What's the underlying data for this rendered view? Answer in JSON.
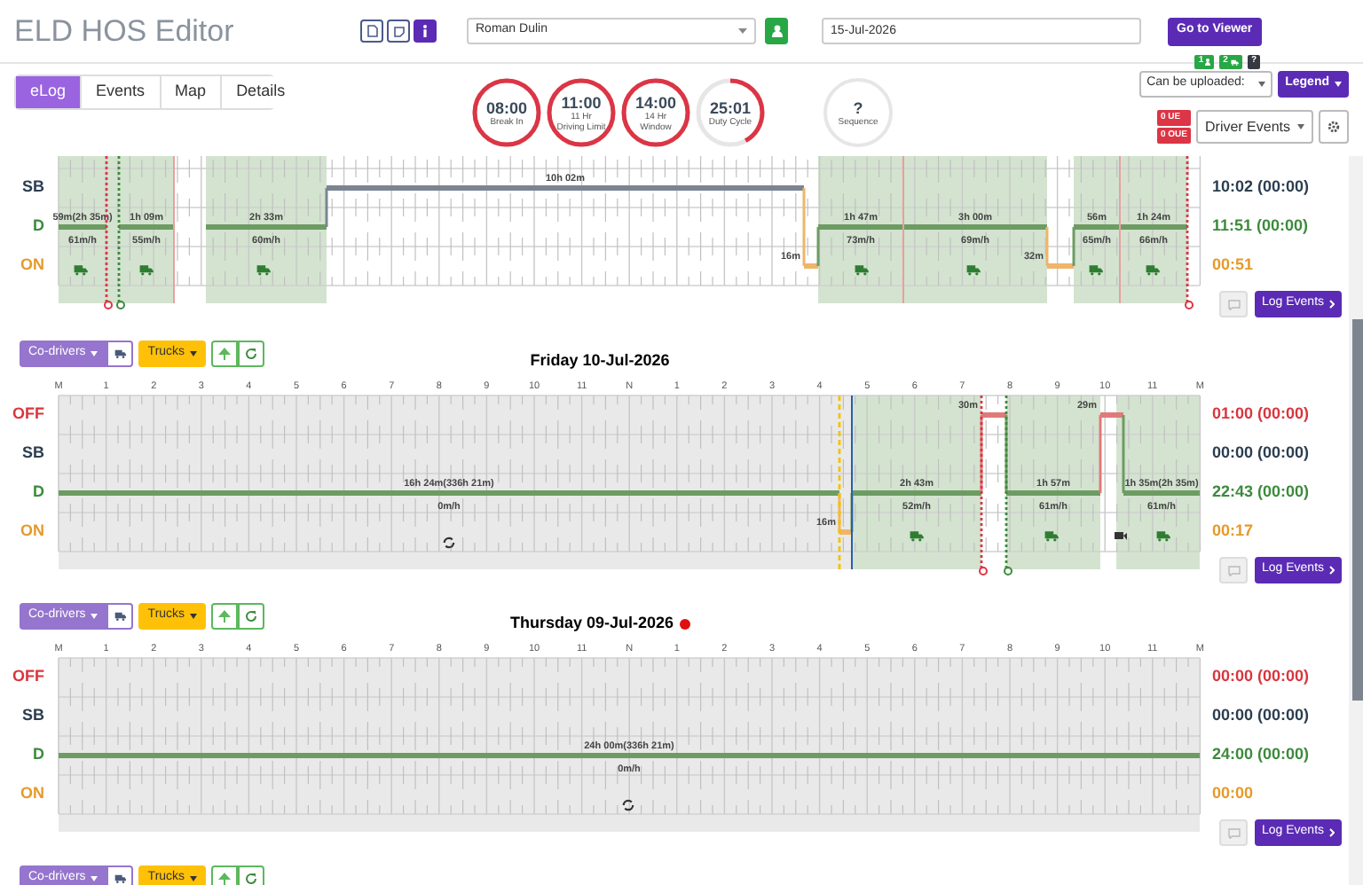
{
  "header": {
    "title": "ELD HOS Editor",
    "driver": {
      "value": "Roman Dulin"
    },
    "date": {
      "value": "15-Jul-2026"
    },
    "viewer_button": "Go to Viewer"
  },
  "tabs": [
    {
      "label": "eLog",
      "selected": true
    },
    {
      "label": "Events",
      "selected": false
    },
    {
      "label": "Map",
      "selected": false
    },
    {
      "label": "Details",
      "selected": false
    }
  ],
  "clocks": [
    {
      "time": "08:00",
      "caption": "Break In",
      "level": 1
    },
    {
      "time": "11:00",
      "sublabel": "11 Hr",
      "caption": "Driving Limit",
      "level": 1
    },
    {
      "time": "14:00",
      "sublabel": "14 Hr",
      "caption": "Window",
      "level": 1
    },
    {
      "time": "25:01",
      "caption": "Duty Cycle",
      "level": 0.42
    }
  ],
  "sequence": {
    "value": "?",
    "caption": "Sequence"
  },
  "sync_badges": [
    {
      "kind": "driver",
      "count": "1"
    },
    {
      "kind": "vehicle",
      "count": "2"
    },
    {
      "kind": "unknown",
      "count": "?"
    }
  ],
  "upload_dropdown": "Can be uploaded:",
  "legend_button": "Legend",
  "counters": [
    "0 UE",
    "0 OUE"
  ],
  "driver_events": "Driver Events",
  "days": [
    {
      "rows": [
        {
          "kind": "sb",
          "label": "SB",
          "total": "10:02 (00:00)"
        },
        {
          "kind": "d",
          "label": "D",
          "total": "11:51 (00:00)"
        },
        {
          "kind": "on",
          "label": "ON",
          "total": "00:51"
        }
      ],
      "segments": [
        {
          "duration": "59m(2h 35m)",
          "speed": "61m/h"
        },
        {
          "duration": "1h 09m",
          "speed": "55m/h"
        },
        {
          "duration": "2h 33m",
          "speed": "60m/h"
        },
        {
          "duration": "10h 02m"
        },
        {
          "duration": "16m"
        },
        {
          "duration": "1h 47m",
          "speed": "73m/h"
        },
        {
          "duration": "3h 00m",
          "speed": "69m/h"
        },
        {
          "duration": "32m"
        },
        {
          "duration": "56m",
          "speed": "65m/h"
        },
        {
          "duration": "1h 24m",
          "speed": "66m/h"
        }
      ],
      "log_events": "Log Events"
    },
    {
      "toolbar": {
        "codrivers": "Co-drivers",
        "trucks": "Trucks"
      },
      "title": "Friday 10-Jul-2026",
      "flagged": false,
      "hour_labels": [
        "M",
        "1",
        "2",
        "3",
        "4",
        "5",
        "6",
        "7",
        "8",
        "9",
        "10",
        "11",
        "N",
        "1",
        "2",
        "3",
        "4",
        "5",
        "6",
        "7",
        "8",
        "9",
        "10",
        "11",
        "M"
      ],
      "rows": [
        {
          "kind": "off",
          "label": "OFF",
          "total": "01:00 (00:00)"
        },
        {
          "kind": "sb",
          "label": "SB",
          "total": "00:00 (00:00)"
        },
        {
          "kind": "d",
          "label": "D",
          "total": "22:43 (00:00)"
        },
        {
          "kind": "on",
          "label": "ON",
          "total": "00:17"
        }
      ],
      "segments": [
        {
          "duration": "16h 24m(336h 21m)",
          "speed": "0m/h"
        },
        {
          "duration": "16m"
        },
        {
          "duration": "2h 43m",
          "speed": "52m/h"
        },
        {
          "duration": "30m"
        },
        {
          "duration": "1h 57m",
          "speed": "61m/h"
        },
        {
          "duration": "29m"
        },
        {
          "duration": "1h 35m(2h 35m)",
          "speed": "61m/h"
        }
      ],
      "log_events": "Log Events"
    },
    {
      "toolbar": {
        "codrivers": "Co-drivers",
        "trucks": "Trucks"
      },
      "title": "Thursday 09-Jul-2026",
      "flagged": true,
      "hour_labels": [
        "M",
        "1",
        "2",
        "3",
        "4",
        "5",
        "6",
        "7",
        "8",
        "9",
        "10",
        "11",
        "N",
        "1",
        "2",
        "3",
        "4",
        "5",
        "6",
        "7",
        "8",
        "9",
        "10",
        "11",
        "M"
      ],
      "rows": [
        {
          "kind": "off",
          "label": "OFF",
          "total": "00:00 (00:00)"
        },
        {
          "kind": "sb",
          "label": "SB",
          "total": "00:00 (00:00)"
        },
        {
          "kind": "d",
          "label": "D",
          "total": "24:00 (00:00)"
        },
        {
          "kind": "on",
          "label": "ON",
          "total": "00:00"
        }
      ],
      "segments": [
        {
          "duration": "24h 00m(336h 21m)",
          "speed": "0m/h"
        }
      ],
      "log_events": "Log Events"
    },
    {
      "toolbar": {
        "codrivers": "Co-drivers",
        "trucks": "Trucks"
      }
    }
  ]
}
